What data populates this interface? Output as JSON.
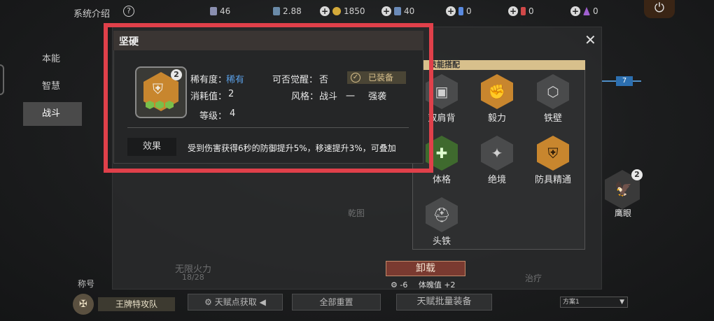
{
  "topbar": {
    "title": "系统介绍",
    "help": "?",
    "resources": [
      {
        "value": "46",
        "color": "#8a8fb0",
        "plus": false
      },
      {
        "value": "2.88",
        "color": "#6a8aa8",
        "plus": false
      },
      {
        "value": "1850",
        "color": "#d4aa3a",
        "plus": true
      },
      {
        "value": "40",
        "color": "#6a8ab8",
        "plus": true
      },
      {
        "value": "0",
        "color": "#5a8ae0",
        "plus": true
      },
      {
        "value": "0",
        "color": "#d04848",
        "plus": true
      },
      {
        "value": "0",
        "color": "#a060d0",
        "plus": true
      }
    ]
  },
  "nav": {
    "items": [
      {
        "label": "本能"
      },
      {
        "label": "智慧"
      },
      {
        "label": "战斗"
      }
    ]
  },
  "background": {
    "fire_label": "无限火力",
    "fire_count": "18/28",
    "heal_label": "治疗",
    "faded_label": "乾图"
  },
  "rail": {
    "badge": "7"
  },
  "hawk": {
    "label": "鹰眼",
    "level": "2"
  },
  "match": {
    "header": "技能搭配",
    "skills": [
      {
        "label": "双肩背",
        "icon": "backpack-icon",
        "style": "gray",
        "glyph": "▣"
      },
      {
        "label": "毅力",
        "icon": "fist-icon",
        "style": "orange",
        "glyph": "✊"
      },
      {
        "label": "铁壁",
        "icon": "honeycomb-icon",
        "style": "gray",
        "glyph": "⬡"
      },
      {
        "label": "体格",
        "icon": "muscle-icon",
        "style": "green",
        "glyph": "💪"
      },
      {
        "label": "绝境",
        "icon": "wings-icon",
        "style": "gray",
        "glyph": "✦"
      },
      {
        "label": "防具精通",
        "icon": "armor-icon",
        "style": "orange",
        "glyph": "⛨"
      },
      {
        "label": "头铁",
        "icon": "helmet-icon",
        "style": "gray",
        "glyph": "⛑"
      }
    ]
  },
  "actions": {
    "unload": "卸载",
    "cost_value": "-6",
    "soul_label": "体魄值 +2"
  },
  "bottom": {
    "title_label": "称号",
    "title_name": "王牌特攻队",
    "talent_get": "天赋点获取",
    "reset_all": "全部重置",
    "batch_equip": "天赋批量装备",
    "plan": "方案1"
  },
  "popup": {
    "title": "坚硬",
    "level_badge": "2",
    "rarity_label": "稀有度：",
    "rarity_value": "稀有",
    "awaken_label": "可否觉醒：",
    "awaken_value": "否",
    "equipped_label": "已装备",
    "cost_label": "消耗值：",
    "cost_value": "2",
    "style_label": "风格：",
    "style_value": "战斗",
    "style_sep": "一",
    "style_value2": "强袭",
    "level_label": "等级：",
    "level_value": "4",
    "effect_tag": "效果",
    "effect_text": "受到伤害获得6秒的防御提升5%，移速提升3%，可叠加"
  }
}
